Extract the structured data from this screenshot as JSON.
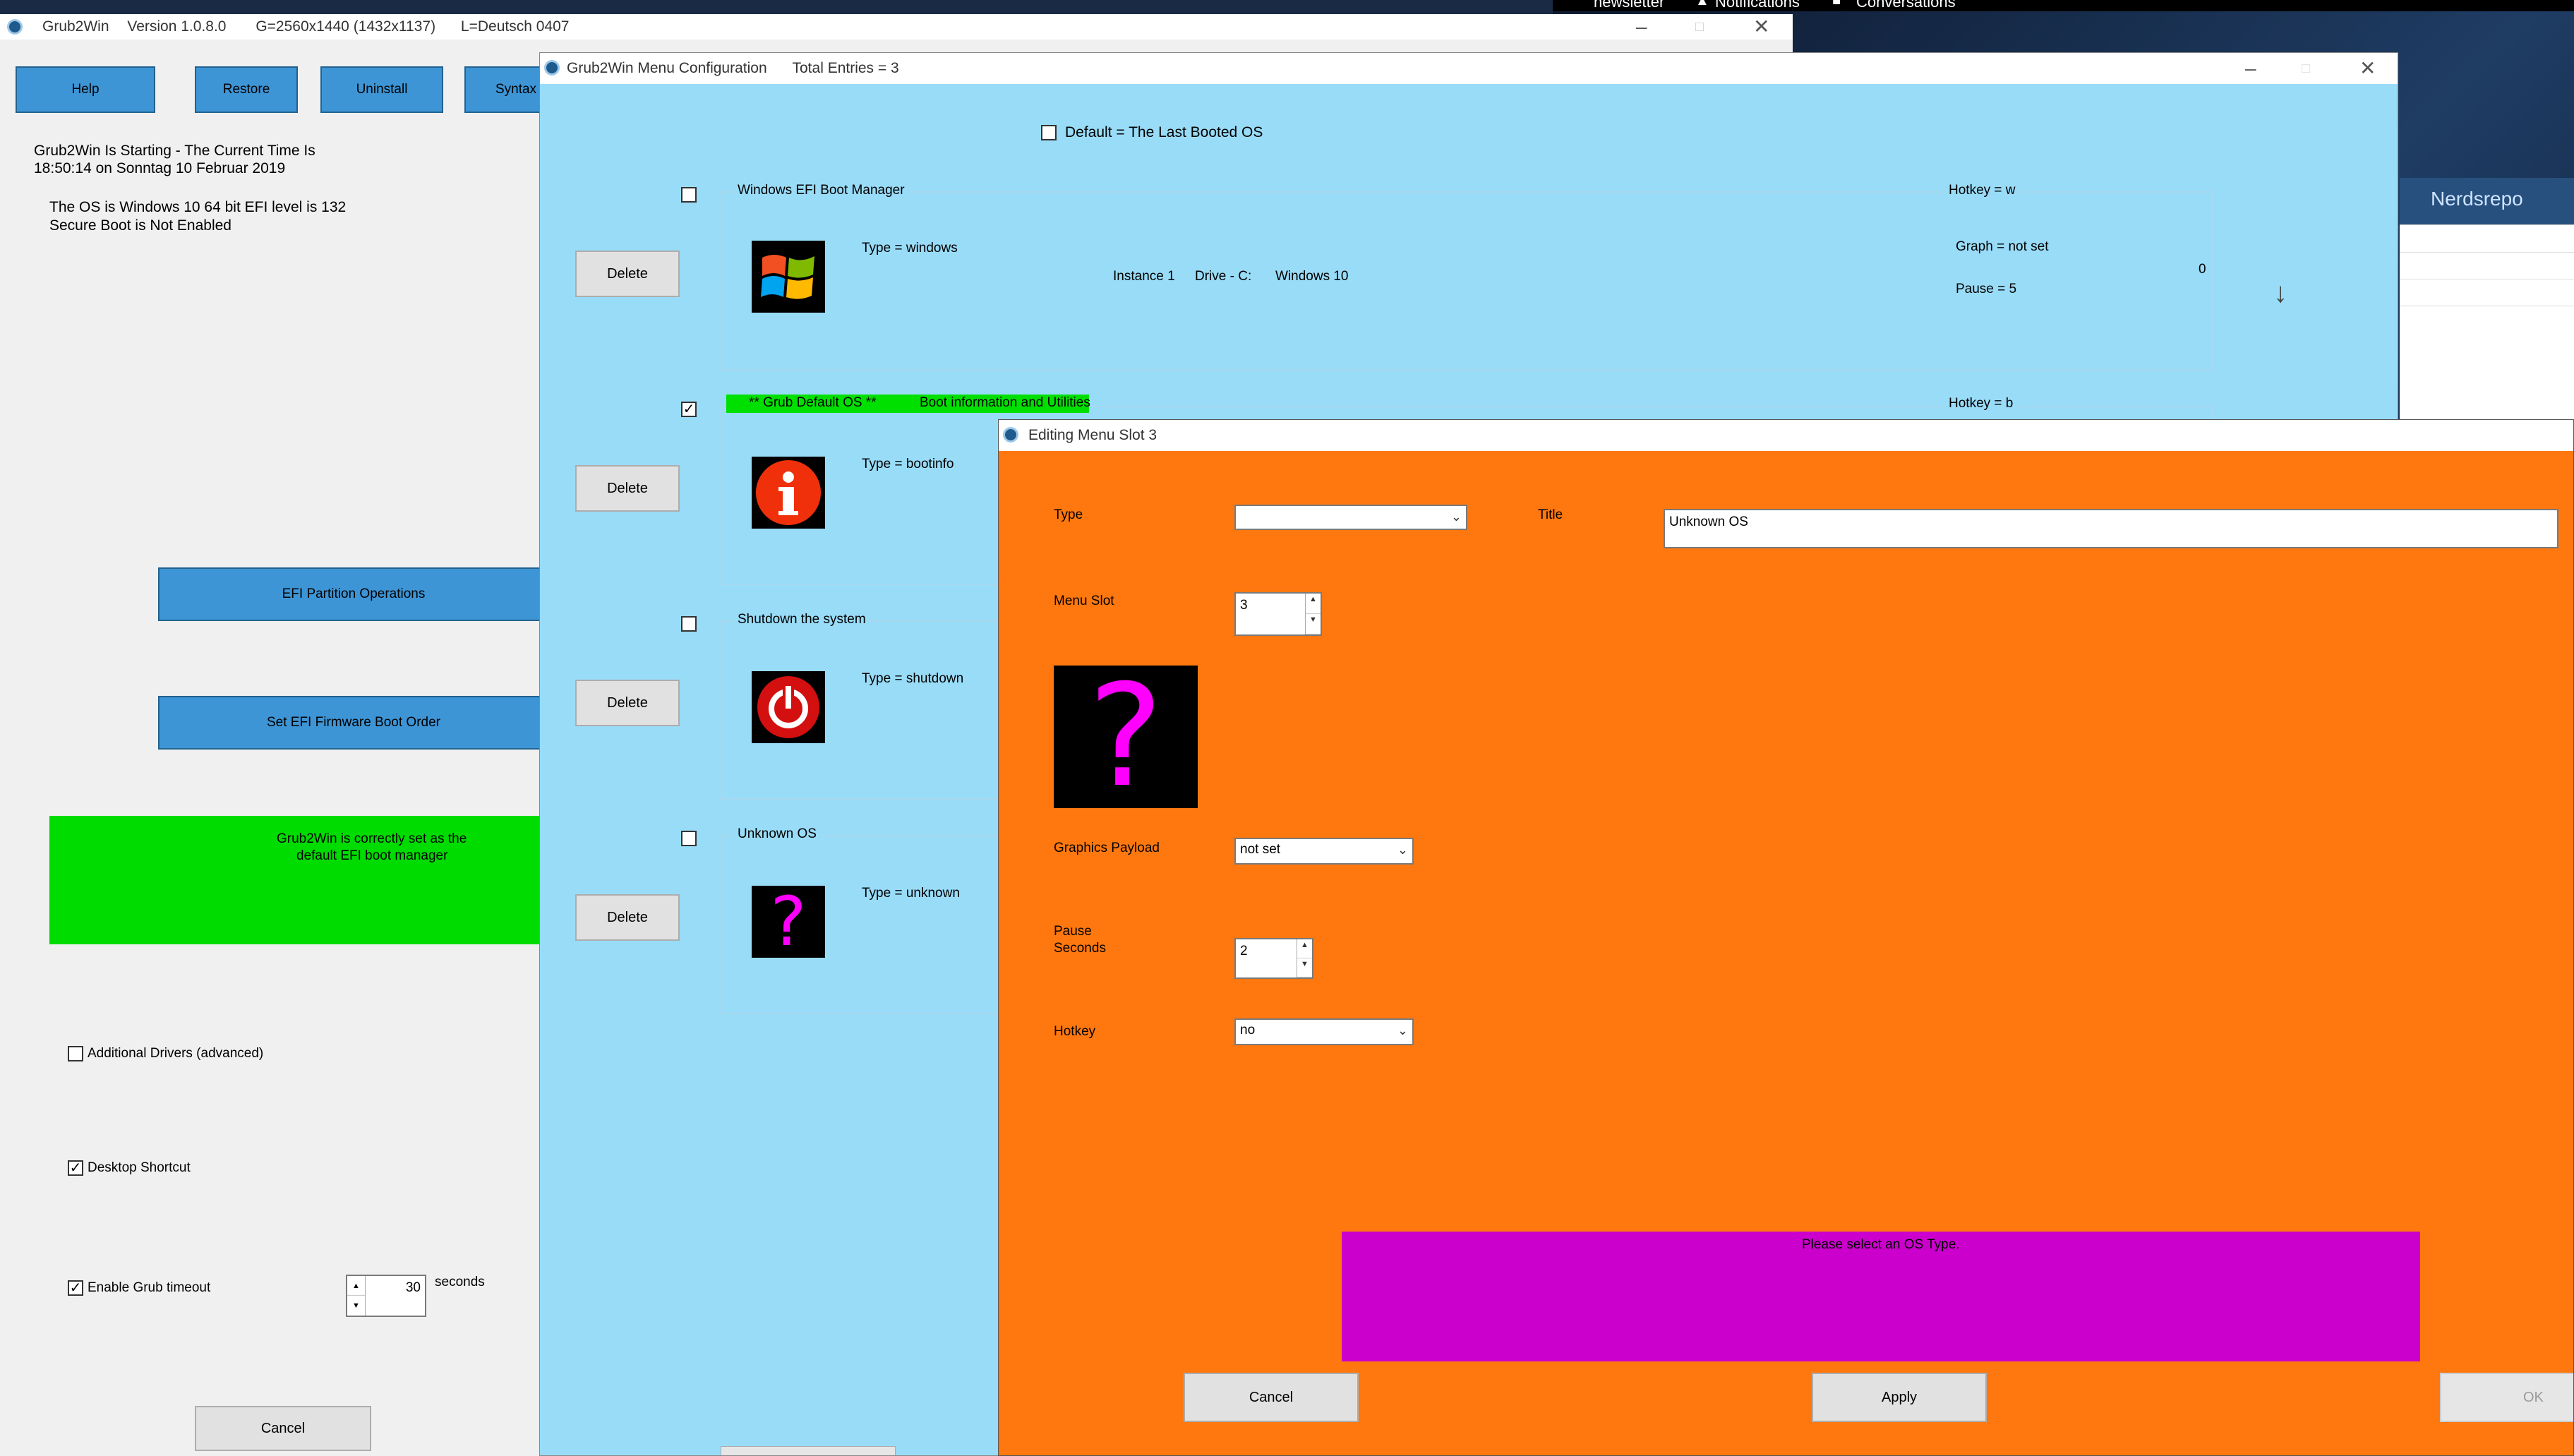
{
  "background_app": {
    "newsletter": "newsletter",
    "notifications": "Notifications",
    "conversations": "Conversations",
    "nerdsrepo": "Nerdsrepo"
  },
  "main_window": {
    "title_app": "Grub2Win",
    "title_version": "Version 1.0.8.0",
    "title_resolution": "G=2560x1440 (1432x1137)",
    "title_lang": "L=Deutsch  0407",
    "buttons": {
      "help": "Help",
      "restore": "Restore",
      "uninstall": "Uninstall",
      "syntax": "Syntax"
    },
    "status_line1": "Grub2Win Is Starting - The Current Time Is",
    "status_line2": "18:50:14  on  Sonntag  10 Februar 2019",
    "os_line1": "The OS is Windows 10   64 bit   EFI level is 132",
    "os_line2": "Secure Boot is Not Enabled",
    "efi_partition_button": "EFI Partition Operations",
    "efi_firmware_button": "Set EFI Firmware Boot Order",
    "green_status_line1": "Grub2Win is correctly set as the",
    "green_status_line2": "default  EFI boot manager",
    "additional_drivers": "Additional Drivers (advanced)",
    "desktop_shortcut": "Desktop Shortcut",
    "enable_timeout": "Enable Grub timeout",
    "timeout_value": "30",
    "seconds_label": "seconds",
    "cancel": "Cancel",
    "additional_drivers_checked": false,
    "desktop_shortcut_checked": true,
    "enable_timeout_checked": true
  },
  "menu_config": {
    "title": "Grub2Win Menu Configuration",
    "total_entries": "Total Entries = 3",
    "default_last_booted": "Default = The Last Booted OS",
    "default_last_booted_checked": false,
    "delete_label": "Delete",
    "entries": [
      {
        "title": "Windows EFI Boot Manager",
        "type": "Type = windows",
        "hotkey": "Hotkey = w",
        "instance": "Instance 1",
        "drive": "Drive - C:",
        "os": "Windows 10",
        "graph": "Graph = not set",
        "pause": "Pause = 5",
        "number": "0",
        "icon": "windows-logo-icon",
        "checked": false
      },
      {
        "title_highlight": "** Grub Default OS **",
        "title": "Boot information and Utilities",
        "type": "Type = bootinfo",
        "hotkey": "Hotkey = b",
        "icon": "info-icon",
        "checked": true
      },
      {
        "title": "Shutdown the system",
        "type": "Type = shutdown",
        "icon": "power-icon",
        "checked": false
      },
      {
        "title": "Unknown OS",
        "type": "Type = unknown",
        "icon": "question-mark-icon",
        "checked": false
      }
    ],
    "arrow_glyph": "↓",
    "colors": {
      "background": "#99dcf8",
      "highlight": "#00e000"
    }
  },
  "edit_dialog": {
    "title": "Editing Menu Slot 3",
    "type_label": "Type",
    "type_value": "",
    "title_label": "Title",
    "title_value": "Unknown OS",
    "menu_slot_label": "Menu Slot",
    "menu_slot_value": "3",
    "graphics_payload_label": "Graphics Payload",
    "graphics_payload_value": "not set",
    "pause_label_1": "Pause",
    "pause_label_2": "Seconds",
    "pause_value": "2",
    "hotkey_label": "Hotkey",
    "hotkey_value": "no",
    "message": "Please select an OS Type.",
    "cancel": "Cancel",
    "apply": "Apply",
    "ok": "OK",
    "colors": {
      "background": "#ff780f",
      "message_box": "#cc00cc",
      "question_mark": "#ff00ff"
    }
  }
}
